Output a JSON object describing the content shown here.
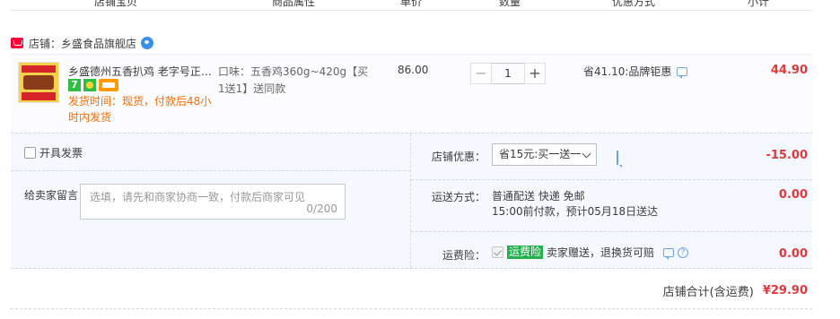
{
  "columns": {
    "item": "店铺宝贝",
    "attrs": "商品属性",
    "price": "单价",
    "qty": "数量",
    "promo": "优惠方式",
    "subtotal": "小计"
  },
  "shop": {
    "badge_icon": "tmall-icon",
    "label": "店铺：乡盛食品旗舰店",
    "chat_icon": "wangwang-icon"
  },
  "item": {
    "title": "乡盛德州五香扒鸡 老字号正宗...",
    "service_icons": [
      "7-day-return-icon",
      "guarantee-icon",
      "card-icon"
    ],
    "service_7": "7",
    "ship_time": "发货时间：现货，付款后48小时内发货",
    "attrs": "口味：五香鸡360g~420g【买1送1】送同款",
    "price": "86.00",
    "qty_minus": "−",
    "qty_value": "1",
    "qty_plus": "+",
    "promo": "省41.10:品牌钜惠",
    "subtotal": "44.90"
  },
  "invoice": {
    "label": "开具发票"
  },
  "message": {
    "label": "给卖家留言：",
    "placeholder": "选填，请先和商家协商一致，付款后商家可见",
    "counter": "0/200"
  },
  "coupon": {
    "label": "店铺优惠：",
    "selected": "省15元:买一送一",
    "amount": "-15.00"
  },
  "shipping": {
    "label": "运送方式：",
    "method": "普通配送 快递 免邮",
    "note": "15:00前付款，预计05月18日送达",
    "fee": "0.00"
  },
  "insurance": {
    "label": "运费险：",
    "badge": "运费险",
    "text": "卖家赠送，退换货可赔",
    "fee": "0.00"
  },
  "total": {
    "label": "店铺合计(含运费)",
    "value": "¥29.90"
  },
  "colors": {
    "accent_red": "#e4393c",
    "ship_orange": "#ff6a00",
    "insurance_green": "#21b04a"
  }
}
